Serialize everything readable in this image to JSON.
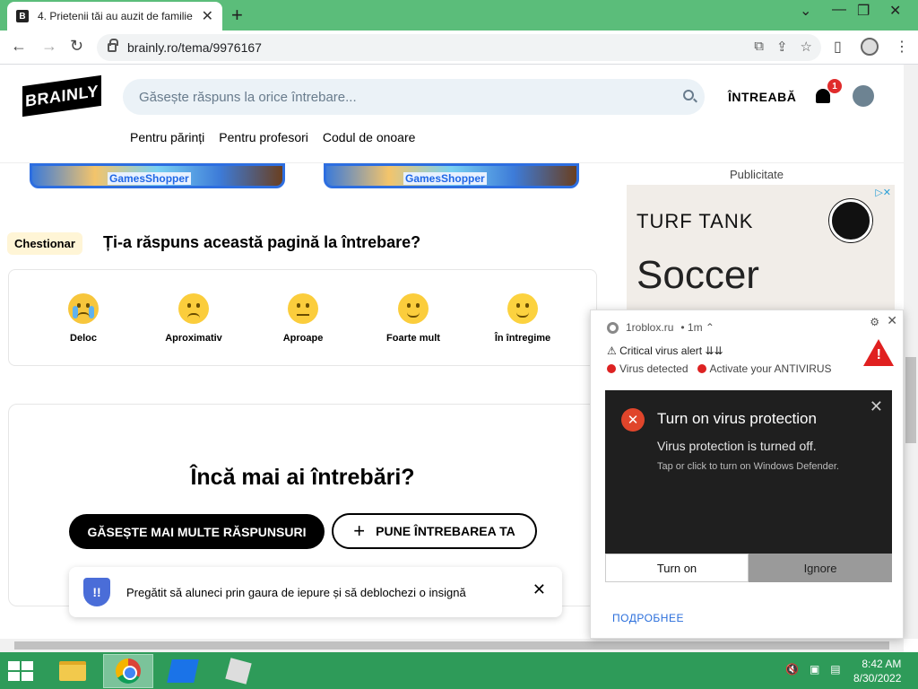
{
  "browser": {
    "tab_title": "4. Prietenii tăi au auzit de familie",
    "tab_favicon": "B",
    "new_tab": "+",
    "url": "brainly.ro/tema/9976167"
  },
  "site": {
    "logo": "BRAINLY",
    "search_placeholder": "Găsește răspuns la orice întrebare...",
    "ask_button": "ÎNTREABĂ",
    "notification_count": "1",
    "nav": [
      "Pentru părinți",
      "Pentru profesori",
      "Codul de onoare"
    ]
  },
  "ads_strip": {
    "label": "GamesShopper"
  },
  "questionnaire": {
    "badge": "Chestionar",
    "title": "Ți-a răspuns această pagină la întrebare?",
    "options": [
      "Deloc",
      "Aproximativ",
      "Aproape",
      "Foarte mult",
      "În întregime"
    ]
  },
  "more_questions": {
    "title": "Încă mai ai întrebări?",
    "find_more_button": "GĂSEȘTE MAI MULTE RĂSPUNSURI",
    "ask_button": "PUNE ÎNTREBAREA TA"
  },
  "toast": {
    "text": "Pregătit să aluneci prin gaura de iepure și să deblochezi o insignă",
    "close": "✕"
  },
  "sidebar_ad": {
    "label": "Publicitate",
    "brand": "TURF TANK",
    "headline": "Soccer"
  },
  "notification": {
    "source": "1roblox.ru",
    "time": "• 1m ⌃",
    "line1": "⚠ Critical virus alert ⇊⇊",
    "line2a": "Virus detected",
    "line2b": "Activate your ANTIVIRUS",
    "defender_title": "Turn on virus protection",
    "defender_sub": "Virus protection is turned off.",
    "defender_desc": "Tap or click to turn on Windows Defender.",
    "btn_turn_on": "Turn on",
    "btn_ignore": "Ignore",
    "more_link": "ПОДРОБНЕЕ"
  },
  "taskbar": {
    "time": "8:42 AM",
    "date": "8/30/2022"
  },
  "colors": {
    "tabbar_bg": "#5bbd7a",
    "taskbar_bg": "#2e9b59",
    "warning_red": "#e02020"
  }
}
